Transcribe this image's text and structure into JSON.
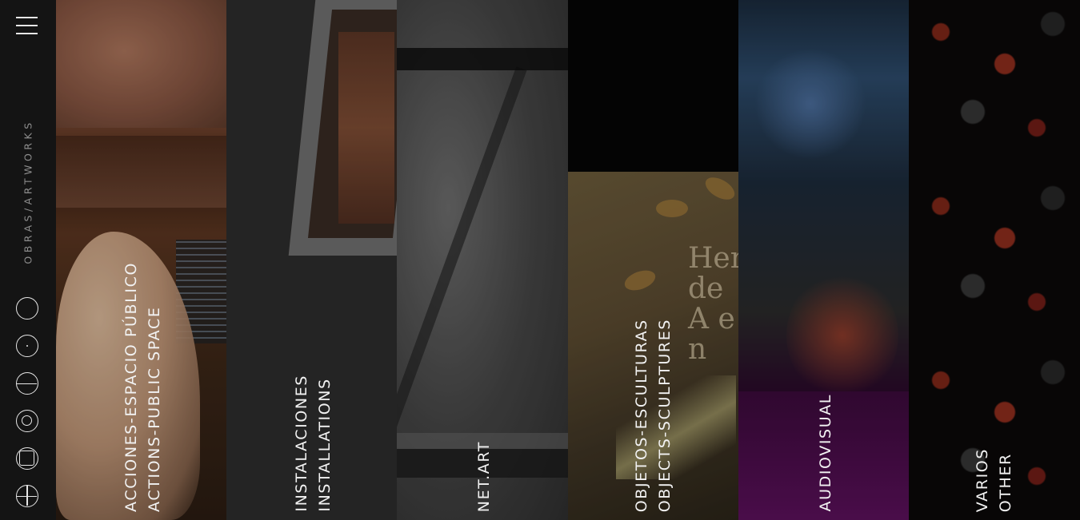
{
  "rail": {
    "menu_icon": "hamburger-menu-icon",
    "section_label": "OBRAS/ARTWORKS",
    "icons": [
      "circle-icon",
      "circle-dot-icon",
      "circle-horizontal-line-icon",
      "concentric-circles-icon",
      "circle-square-icon",
      "circle-cross-icon"
    ]
  },
  "panels": [
    {
      "line1": "ACCIONES-ESPACIO PÚBLICO",
      "line2": "ACTIONS-PUBLIC SPACE"
    },
    {
      "line1": "INSTALACIONES",
      "line2": "INSTALLATIONS"
    },
    {
      "line1": "NET.ART",
      "line2": ""
    },
    {
      "line1": "OBJETOS-ESCULTURAS",
      "line2": "OBJECTS-SCULPTURES"
    },
    {
      "line1": "AUDIOVISUAL",
      "line2": ""
    },
    {
      "line1": "VARIOS",
      "line2": "OTHER"
    }
  ],
  "book_cover_text": "Her de A e n"
}
